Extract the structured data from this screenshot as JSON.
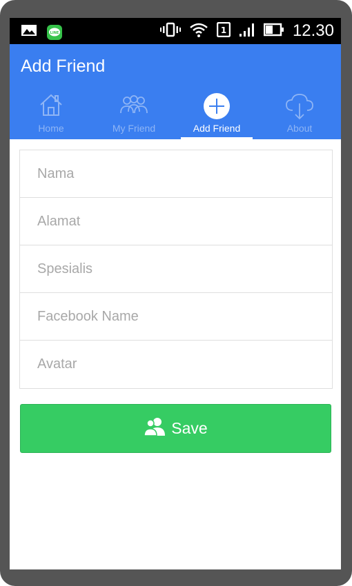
{
  "status_bar": {
    "time": "12.30",
    "left_icons": [
      "gallery-icon",
      "line-app-icon"
    ],
    "line_badge_text": "LINE",
    "right_icons": [
      "vibrate-icon",
      "wifi-icon",
      "sim-icon",
      "signal-icon",
      "battery-icon"
    ],
    "sim_number": "1"
  },
  "app_bar": {
    "title": "Add Friend",
    "color": "#3a7ef0"
  },
  "tabs": [
    {
      "label": "Home",
      "icon": "home-icon",
      "active": false
    },
    {
      "label": "My Friend",
      "icon": "friends-icon",
      "active": false
    },
    {
      "label": "Add Friend",
      "icon": "plus-circle-icon",
      "active": true
    },
    {
      "label": "About",
      "icon": "cloud-download-icon",
      "active": false
    }
  ],
  "form": {
    "fields": [
      {
        "placeholder": "Nama",
        "value": ""
      },
      {
        "placeholder": "Alamat",
        "value": ""
      },
      {
        "placeholder": "Spesialis",
        "value": ""
      },
      {
        "placeholder": "Facebook Name",
        "value": ""
      },
      {
        "placeholder": "Avatar",
        "value": ""
      }
    ]
  },
  "save_button": {
    "label": "Save",
    "icon": "users-icon",
    "color": "#36cc63"
  }
}
